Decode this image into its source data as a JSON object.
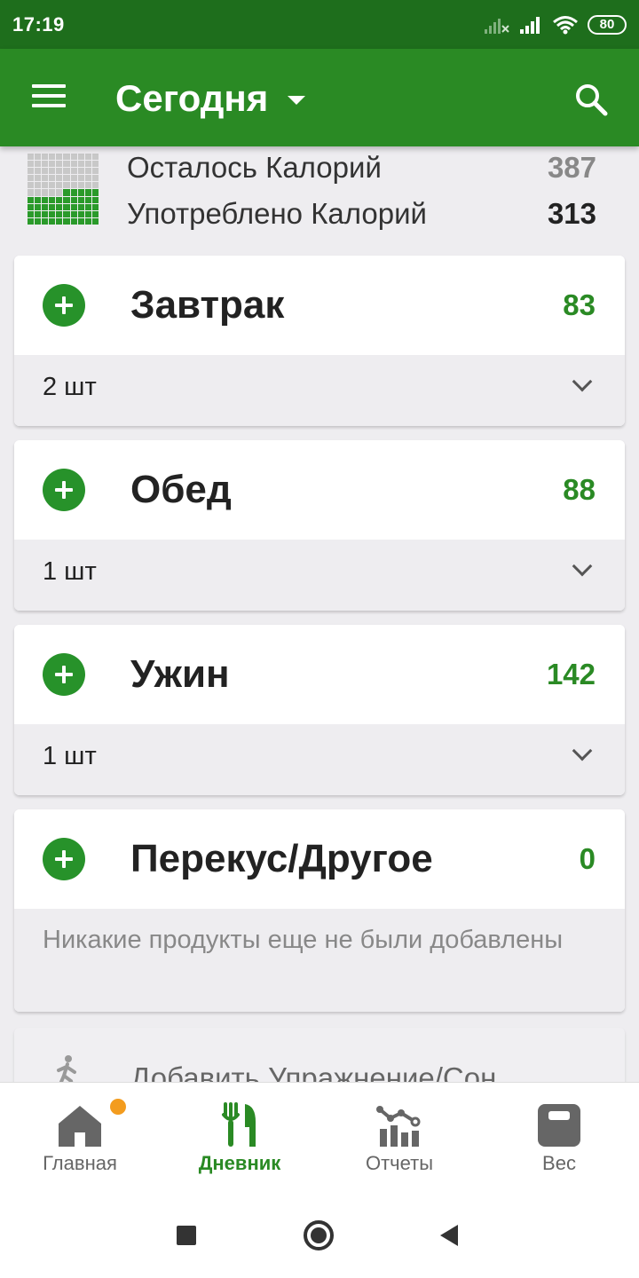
{
  "status_bar": {
    "time": "17:19",
    "battery": "80",
    "icons": [
      "signal-x-icon",
      "signal-icon",
      "wifi-icon",
      "battery-icon"
    ]
  },
  "app_bar": {
    "title": "Сегодня",
    "icons": [
      "menu-icon",
      "dropdown-caret-icon",
      "search-icon"
    ],
    "color": "#2a8a24"
  },
  "summary": {
    "remaining_label": "Осталось Калорий",
    "remaining_value": "387",
    "consumed_label": "Употреблено Калорий",
    "consumed_value": "313",
    "consumed_fraction": 0.45
  },
  "meals": [
    {
      "name": "Завтрак",
      "calories": "83",
      "count": "2 шт"
    },
    {
      "name": "Обед",
      "calories": "88",
      "count": "1 шт"
    },
    {
      "name": "Ужин",
      "calories": "142",
      "count": "1 шт"
    },
    {
      "name": "Перекус/Другое",
      "calories": "0",
      "empty_text": "Никакие продукты еще не были добавлены"
    }
  ],
  "exercise": {
    "label": "Добавить Упражнение/Сон",
    "icon": "walking-person-icon"
  },
  "bottom_nav": {
    "items": [
      {
        "label": "Главная",
        "icon": "home-icon",
        "active": false,
        "has_notification": true
      },
      {
        "label": "Дневник",
        "icon": "fork-knife-icon",
        "active": true
      },
      {
        "label": "Отчеты",
        "icon": "reports-chart-icon",
        "active": false
      },
      {
        "label": "Вес",
        "icon": "scale-icon",
        "active": false
      }
    ]
  },
  "colors": {
    "status_bar": "#1e6e1c",
    "accent": "#2a8a24",
    "notification": "#f39c1e",
    "background": "#eeedf0"
  }
}
